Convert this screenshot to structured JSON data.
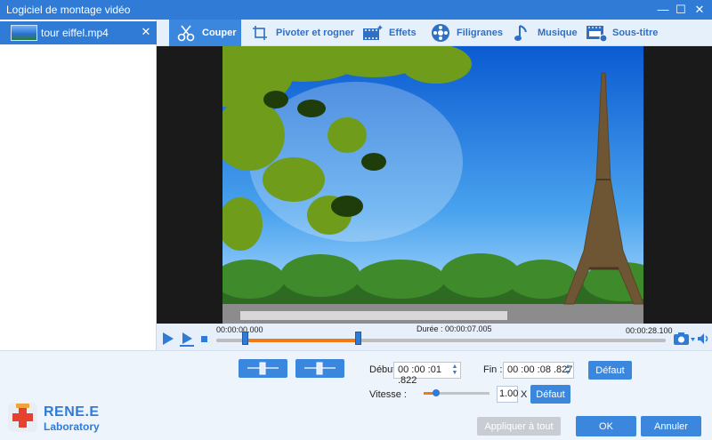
{
  "window": {
    "title": "Logiciel de montage vidéo",
    "minimize": "—",
    "maximize": "☐",
    "close": "✕"
  },
  "files": [
    {
      "name": "tour eiffel.mp4",
      "remove": "✕"
    }
  ],
  "tabs": [
    {
      "label": "Couper",
      "icon": "cut-icon",
      "active": true
    },
    {
      "label": "Pivoter et rogner",
      "icon": "rotate-crop-icon"
    },
    {
      "label": "Effets",
      "icon": "effects-icon"
    },
    {
      "label": "Filigranes",
      "icon": "watermark-icon"
    },
    {
      "label": "Musique",
      "icon": "music-icon"
    },
    {
      "label": "Sous-titre",
      "icon": "subtitle-icon"
    }
  ],
  "timeline": {
    "start": "00:00:00.000",
    "duration": "Durée : 00:00:07.005",
    "end": "00:00:28.100",
    "selection_start_fraction": 0.063,
    "selection_end_fraction": 0.317
  },
  "cut": {
    "start_label": "Début",
    "start_value": "00 :00 :01 .822",
    "end_label": "Fin :",
    "end_value": "00 :00 :08 .827",
    "default_label": "Défaut"
  },
  "speed": {
    "label": "Vitesse :",
    "value": "1.00",
    "unit": "X",
    "default_label": "Défaut",
    "level_fraction": 0.17
  },
  "actions": {
    "apply_all": "Appliquer à tout",
    "ok": "OK",
    "cancel": "Annuler"
  },
  "branding": {
    "name": "RENE.E",
    "sub": "Laboratory"
  },
  "colors": {
    "accent": "#2f7bd6",
    "progress": "#f07a14",
    "tab_bg": "#e6f0fb"
  }
}
